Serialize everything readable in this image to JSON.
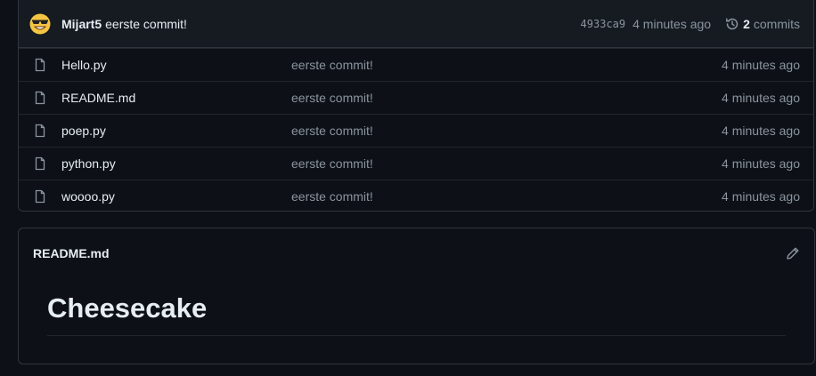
{
  "latest_commit": {
    "author": "Mijart5",
    "message": "eerste commit!",
    "sha": "4933ca9",
    "age": "4 minutes ago",
    "commit_count": "2",
    "commits_label": "commits",
    "avatar_icon": "sunglasses-smiley-avatar"
  },
  "files": [
    {
      "name": "Hello.py",
      "commit_message": "eerste commit!",
      "age": "4 minutes ago",
      "icon": "file-icon"
    },
    {
      "name": "README.md",
      "commit_message": "eerste commit!",
      "age": "4 minutes ago",
      "icon": "file-icon"
    },
    {
      "name": "poep.py",
      "commit_message": "eerste commit!",
      "age": "4 minutes ago",
      "icon": "file-icon"
    },
    {
      "name": "python.py",
      "commit_message": "eerste commit!",
      "age": "4 minutes ago",
      "icon": "file-icon"
    },
    {
      "name": "woooo.py",
      "commit_message": "eerste commit!",
      "age": "4 minutes ago",
      "icon": "file-icon"
    }
  ],
  "readme": {
    "filename": "README.md",
    "heading": "Cheesecake",
    "edit_icon": "pencil-icon"
  },
  "colors": {
    "background": "#0d1117",
    "header_background": "#161b22",
    "border": "#30363d",
    "text": "#e6edf3",
    "muted_text": "#8b949e"
  }
}
